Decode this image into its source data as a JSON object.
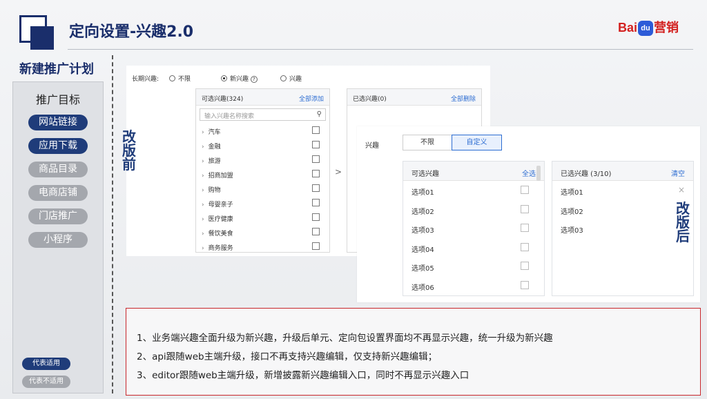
{
  "header": {
    "title": "定向设置-兴趣2.0",
    "brand": {
      "prefix": "Bai",
      "paw": "du",
      "suffix": "营销"
    }
  },
  "sidebar": {
    "plan_title": "新建推广计划",
    "heading": "推广目标",
    "items": [
      {
        "label": "网站链接",
        "active": true
      },
      {
        "label": "应用下载",
        "active": true
      },
      {
        "label": "商品目录",
        "active": false
      },
      {
        "label": "电商店铺",
        "active": false
      },
      {
        "label": "门店推广",
        "active": false
      },
      {
        "label": "小程序",
        "active": false
      }
    ],
    "legend_on": "代表适用",
    "legend_off": "代表不适用"
  },
  "tags": {
    "before": [
      "改",
      "版",
      "前"
    ],
    "after": [
      "改",
      "版",
      "后"
    ]
  },
  "before": {
    "label": "长期兴趣:",
    "radios": [
      {
        "label": "不限",
        "selected": false
      },
      {
        "label": "新兴趣",
        "selected": true,
        "help": "?"
      },
      {
        "label": "兴趣",
        "selected": false
      }
    ],
    "available": {
      "title": "可选兴趣(324)",
      "action": "全部添加",
      "search_placeholder": "输入兴趣名称搜索",
      "items": [
        "汽车",
        "金融",
        "旅游",
        "招商加盟",
        "购物",
        "母婴亲子",
        "医疗健康",
        "餐饮美食",
        "商务服务"
      ]
    },
    "arrow": ">",
    "selected": {
      "title": "已选兴趣(0)",
      "action": "全部删除"
    }
  },
  "after": {
    "label": "兴趣",
    "segments": [
      {
        "label": "不限",
        "active": false
      },
      {
        "label": "自定义",
        "active": true
      }
    ],
    "available": {
      "title": "可选兴趣",
      "action": "全选",
      "items": [
        "选项01",
        "选项02",
        "选项03",
        "选项04",
        "选项05",
        "选项06"
      ]
    },
    "selected": {
      "title": "已选兴趣 (3/10)",
      "action": "清空",
      "items": [
        "选项01",
        "选项02",
        "选项03"
      ],
      "close": "×"
    }
  },
  "notes": [
    "1、业务端兴趣全面升级为新兴趣，升级后单元、定向包设置界面均不再显示兴趣，统一升级为新兴趣",
    "2、api跟随web主端升级，接口不再支持兴趣编辑，仅支持新兴趣编辑；",
    "3、editor跟随web主端升级，新增披露新兴趣编辑入口，同时不再显示兴趣入口"
  ],
  "colors": {
    "navy": "#1a2e6b",
    "accent_red": "#c8262b",
    "link_blue": "#2d6dd2"
  }
}
